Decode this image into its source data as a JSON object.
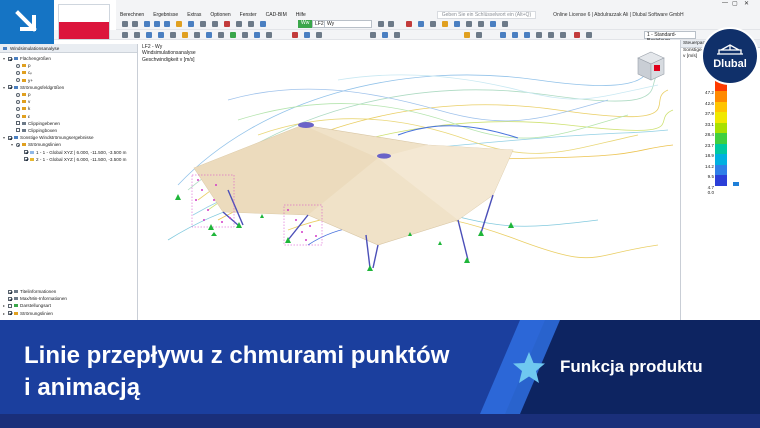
{
  "app": {
    "license_text": "Online License 6 | Abdulrazzak Ali | Dlubal Software GmbH",
    "search_placeholder": "Geben Sie ein Schlüsselwort ein (Alt+Q)",
    "menu": [
      "Berechnen",
      "Ergebnisse",
      "Extras",
      "Optionen",
      "Fenster",
      "CAD-BIM",
      "Hilfe"
    ],
    "load_case": {
      "tag": "Ww",
      "id": "LF2",
      "name": "Wy"
    },
    "view_selector": "1 - Standard-Basislayer",
    "zoom_hint": "Steuerpan"
  },
  "navigator": {
    "title": "Windsimulationsanalyse",
    "items": [
      {
        "label": "Flächengrößen",
        "level": 0,
        "control": "checkbox",
        "checked": true,
        "expanded": true
      },
      {
        "label": "p",
        "level": 1,
        "control": "radio",
        "checked": false
      },
      {
        "label": "cₚ",
        "level": 1,
        "control": "radio",
        "checked": false
      },
      {
        "label": "y+",
        "level": 1,
        "control": "radio",
        "checked": false
      },
      {
        "label": "Strömungsfeldgrößen",
        "level": 0,
        "control": "checkbox",
        "checked": true,
        "expanded": true
      },
      {
        "label": "p",
        "level": 1,
        "control": "radio",
        "checked": false
      },
      {
        "label": "v",
        "level": 1,
        "control": "radio",
        "checked": false
      },
      {
        "label": "k",
        "level": 1,
        "control": "radio",
        "checked": false
      },
      {
        "label": "ε",
        "level": 1,
        "control": "radio",
        "checked": false
      },
      {
        "label": "Clippingebenen",
        "level": 1,
        "control": "checkbox",
        "checked": false
      },
      {
        "label": "Clippingboxen",
        "level": 1,
        "control": "checkbox",
        "checked": false
      },
      {
        "label": "Sonstige Windströmungsergebnisse",
        "level": 0,
        "control": "checkbox",
        "checked": true,
        "expanded": true
      },
      {
        "label": "Strömungslinien",
        "level": 1,
        "control": "radio",
        "checked": true
      },
      {
        "label": "1 - 1 - Global XYZ | 6.000, -11.500, -3.500 m",
        "level": 2,
        "control": "checkbox",
        "checked": true,
        "swatch": "#8fb8e8"
      },
      {
        "label": "2 - 1 - Global XYZ | 6.000, -11.500, -3.500 m",
        "level": 2,
        "control": "checkbox",
        "checked": true,
        "swatch": "#e8b830"
      }
    ],
    "bottom_items": [
      {
        "label": "Titelinformationen",
        "control": "checkbox",
        "checked": true
      },
      {
        "label": "Max/Min-Informationen",
        "control": "checkbox",
        "checked": true
      },
      {
        "label": "Darstellungsart",
        "control": "checkbox",
        "checked": false
      },
      {
        "label": "Strömungslinien",
        "control": "checkbox",
        "checked": true
      }
    ]
  },
  "viewport": {
    "info_lines": [
      "LF2 - Wy",
      "Windsimulationsanalyse",
      "Geschwindigkeit v [m/s]"
    ]
  },
  "legend": {
    "title": "Steuerpan",
    "sublabels": [
      "Sonstige",
      "v [m/s]"
    ],
    "values": [
      "",
      "47.2",
      "42.6",
      "37.9",
      "33.1",
      "28.4",
      "23.7",
      "18.9",
      "14.2",
      "9.5",
      "4.7",
      "0.0"
    ],
    "colors": [
      "#e0001b",
      "#ff3a00",
      "#ff8a00",
      "#ffc400",
      "#f0e800",
      "#a8e000",
      "#3fcf3f",
      "#00c8a0",
      "#00b0e0",
      "#2f7fe8",
      "#2b3fd8",
      "#1a1a9e"
    ]
  },
  "logo": {
    "text": "Dlubal"
  },
  "banner": {
    "title_line1": "Linie przepływu z chmurami punktów",
    "title_line2": "i animacją",
    "badge": "Funkcja produktu",
    "colors": {
      "dark": "#0d2461",
      "mid": "#1b4fbf",
      "accent": "#2f6fe0"
    }
  },
  "overlay": {
    "flag": "poland-flag",
    "corner_icon": "arrow-down-right-icon"
  }
}
